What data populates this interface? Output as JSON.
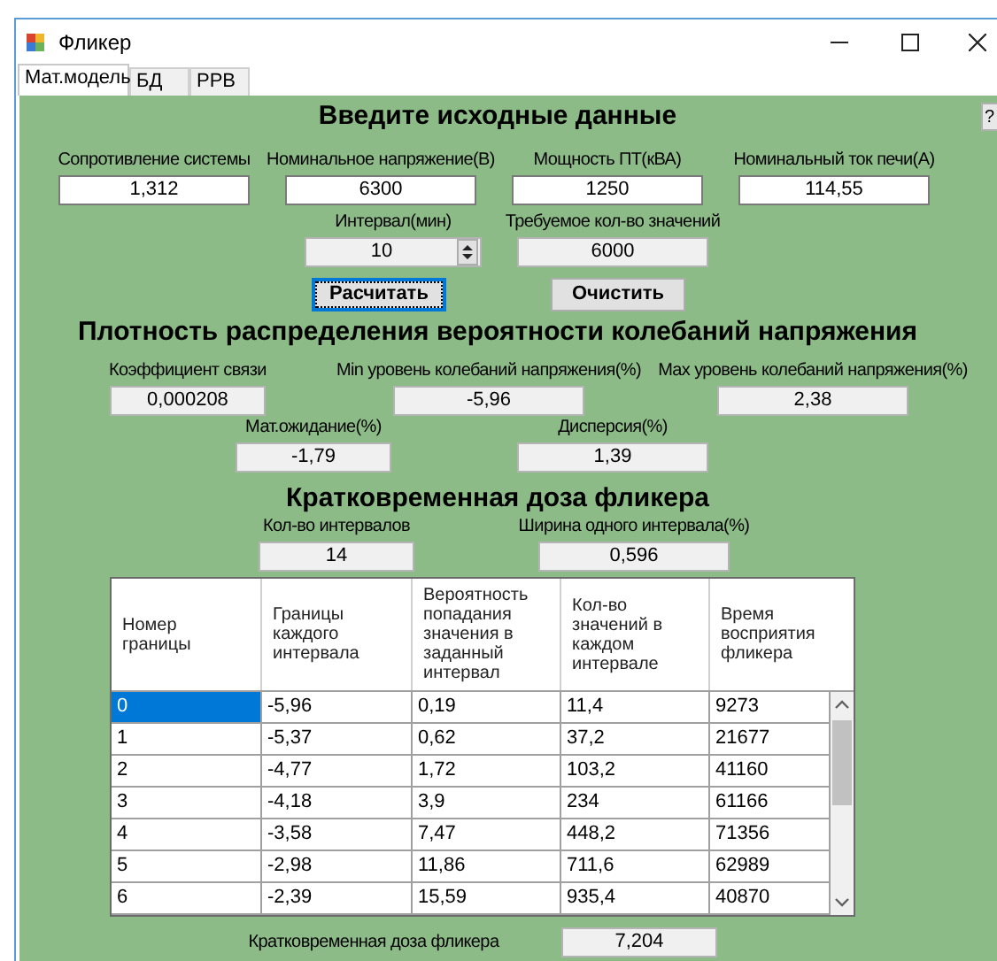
{
  "window": {
    "title": "Фликер"
  },
  "tabs": [
    {
      "label": "Мат.модель",
      "selected": true
    },
    {
      "label": "БД",
      "selected": false
    },
    {
      "label": "РРВ",
      "selected": false
    }
  ],
  "help_button": "?",
  "input_section": {
    "heading": "Введите исходные данные",
    "fields": [
      {
        "kind": "text",
        "label": "Сопротивление системы",
        "value": "1,312",
        "readonly": false
      },
      {
        "kind": "text",
        "label": "Номинальное напряжение(В)",
        "value": "6300",
        "readonly": false
      },
      {
        "kind": "text",
        "label": "Мощность ПТ(кВА)",
        "value": "1250",
        "readonly": false
      },
      {
        "kind": "text",
        "label": "Номинальный ток печи(А)",
        "value": "114,55",
        "readonly": false
      },
      {
        "kind": "spinner",
        "label": "Интервал(мин)",
        "value": "10",
        "readonly": true
      },
      {
        "kind": "text",
        "label": "Требуемое кол-во значений",
        "value": "6000",
        "readonly": true
      }
    ]
  },
  "buttons": [
    {
      "label": "Расчитать",
      "focused": true
    },
    {
      "label": "Очистить",
      "focused": false
    }
  ],
  "density_section": {
    "heading": "Плотность распределения вероятности колебаний напряжения",
    "fields": [
      {
        "kind": "text",
        "label": "Коэффициент связи",
        "value": "0,000208",
        "readonly": true
      },
      {
        "kind": "text",
        "label": "Min уровень колебаний напряжения(%)",
        "value": "-5,96",
        "readonly": true
      },
      {
        "kind": "text",
        "label": "Max уровень колебаний напряжения(%)",
        "value": "2,38",
        "readonly": true
      },
      {
        "kind": "text",
        "label": "Мат.ожидание(%)",
        "value": "-1,79",
        "readonly": true
      },
      {
        "kind": "text",
        "label": "Дисперсия(%)",
        "value": "1,39",
        "readonly": true
      }
    ]
  },
  "flicker_section": {
    "heading": "Кратковременная доза фликера",
    "fields": [
      {
        "kind": "text",
        "label": "Кол-во интервалов",
        "value": "14",
        "readonly": true
      },
      {
        "kind": "text",
        "label": "Ширина одного интервала(%)",
        "value": "0,596",
        "readonly": true
      }
    ],
    "table": {
      "columns": [
        "Номер границы",
        "Границы каждого интервала",
        "Вероятность попадания значения в заданный интервал",
        "Кол-во значений в каждом интервале",
        "Время восприятия фликера"
      ],
      "rows": [
        {
          "selected": true,
          "cells": [
            "0",
            "-5,96",
            "0,19",
            "11,4",
            "9273"
          ]
        },
        {
          "selected": false,
          "cells": [
            "1",
            "-5,37",
            "0,62",
            "37,2",
            "21677"
          ]
        },
        {
          "selected": false,
          "cells": [
            "2",
            "-4,77",
            "1,72",
            "103,2",
            "41160"
          ]
        },
        {
          "selected": false,
          "cells": [
            "3",
            "-4,18",
            "3,9",
            "234",
            "61166"
          ]
        },
        {
          "selected": false,
          "cells": [
            "4",
            "-3,58",
            "7,47",
            "448,2",
            "71356"
          ]
        },
        {
          "selected": false,
          "cells": [
            "5",
            "-2,98",
            "11,86",
            "711,6",
            "62989"
          ]
        },
        {
          "selected": false,
          "cells": [
            "6",
            "-2,39",
            "15,59",
            "935,4",
            "40870"
          ]
        }
      ]
    },
    "result": {
      "kind": "text",
      "label": "Кратковременная доза фликера",
      "value": "7,204",
      "readonly": true
    }
  }
}
